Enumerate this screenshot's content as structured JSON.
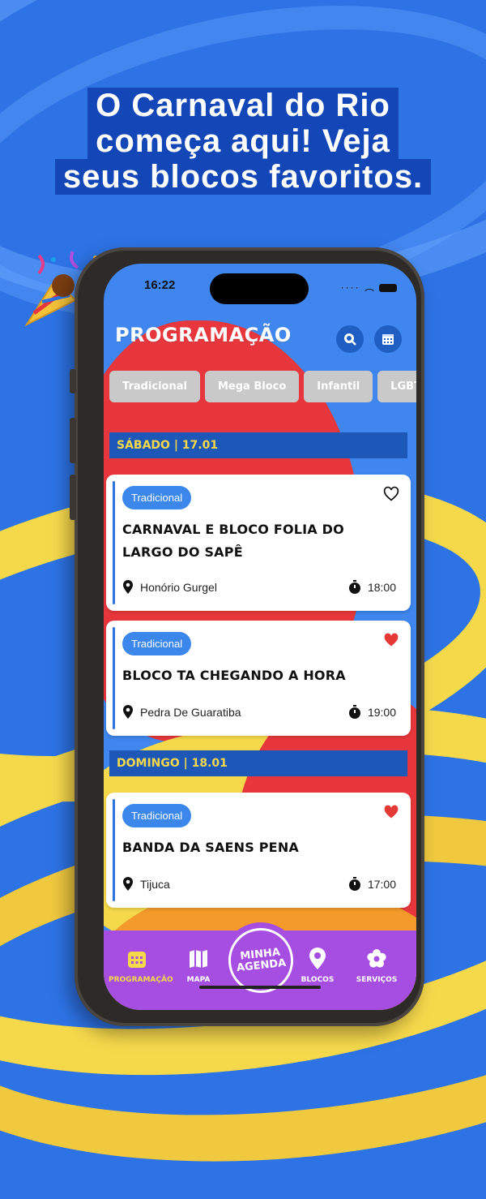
{
  "headline": {
    "line1": "O Carnaval do Rio",
    "line2": "começa aqui! Veja",
    "line3": "seus blocos favoritos."
  },
  "status_bar": {
    "time": "16:22"
  },
  "app": {
    "title": "PROGRAMAÇÃO",
    "search_icon": "search-icon",
    "calendar_icon": "calendar-icon"
  },
  "filters": [
    "Tradicional",
    "Mega Bloco",
    "Infantil",
    "LGBTQ"
  ],
  "days": [
    {
      "label": "SÁBADO | 17.01",
      "events": [
        {
          "tag": "Tradicional",
          "title": "CARNAVAL E BLOCO FOLIA DO LARGO DO SAPÊ",
          "location": "Honório Gurgel",
          "time": "18:00",
          "favorite": false
        },
        {
          "tag": "Tradicional",
          "title": "BLOCO TA CHEGANDO A HORA",
          "location": "Pedra De Guaratiba",
          "time": "19:00",
          "favorite": true
        }
      ]
    },
    {
      "label": "DOMINGO | 18.01",
      "events": [
        {
          "tag": "Tradicional",
          "title": "BANDA DA SAENS PENA",
          "location": "Tijuca",
          "time": "17:00",
          "favorite": true
        }
      ]
    }
  ],
  "nav": {
    "programacao": "PROGRAMAÇÃO",
    "mapa": "MAPA",
    "agenda_line1": "MINHA",
    "agenda_line2": "AGENDA",
    "blocos": "BLOCOS",
    "servicos": "SERVIÇOS"
  },
  "colors": {
    "background_blue": "#2d73e6",
    "yellow": "#f6d94b",
    "red": "#e8373c",
    "purple_nav": "#a64ee2",
    "favorite_red": "#e53935"
  }
}
